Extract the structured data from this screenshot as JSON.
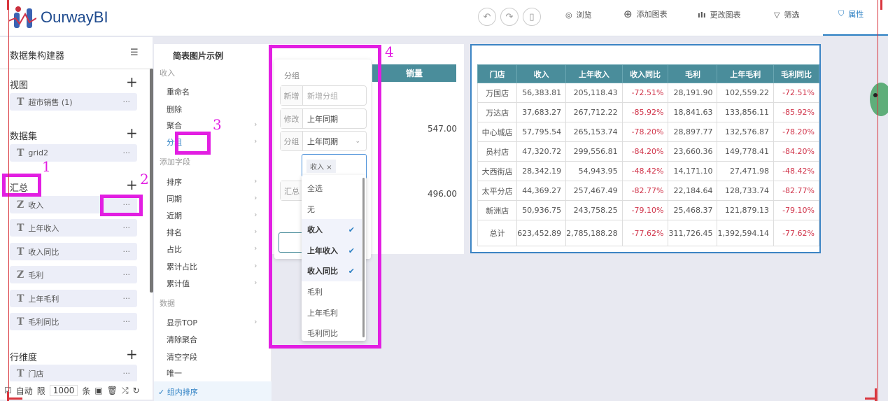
{
  "header": {
    "app_name": "OurwayBI",
    "tools": [
      {
        "icon": "eye-icon",
        "label": "浏览"
      },
      {
        "icon": "plus-circle-icon",
        "label": "添加图表"
      },
      {
        "icon": "bar-chart-icon",
        "label": "更改图表"
      },
      {
        "icon": "filter-icon",
        "label": "筛选"
      },
      {
        "icon": "shirt-icon",
        "label": "属性"
      }
    ]
  },
  "left": {
    "title": "数据集构建器",
    "sections": [
      {
        "title": "视图",
        "fields": [
          {
            "type": "T",
            "name": "超市销售 (1)"
          }
        ]
      },
      {
        "title": "数据集",
        "fields": [
          {
            "type": "T",
            "name": "grid2"
          }
        ]
      },
      {
        "title": "汇总",
        "fields": [
          {
            "type": "Z",
            "name": "收入"
          },
          {
            "type": "T",
            "name": "上年收入"
          },
          {
            "type": "T",
            "name": "收入同比"
          },
          {
            "type": "Z",
            "name": "毛利"
          },
          {
            "type": "T",
            "name": "上年毛利"
          },
          {
            "type": "T",
            "name": "毛利同比"
          }
        ]
      },
      {
        "title": "行维度",
        "fields": [
          {
            "type": "T",
            "name": "门店"
          }
        ]
      }
    ],
    "more": "···"
  },
  "bottom": {
    "auto": "自动",
    "limit_label": "限",
    "limit": "1000",
    "unit": "条"
  },
  "chart_title": "简表图片示例",
  "menu": {
    "header1": "收入",
    "items1": [
      "重命名",
      "删除",
      "聚合",
      "分组"
    ],
    "header2": "添加字段",
    "items2": [
      "排序",
      "同期",
      "近期",
      "排名",
      "占比",
      "累计占比",
      "累计值"
    ],
    "header3": "数据",
    "items3": [
      "显示TOP",
      "清除聚合",
      "清空字段",
      "唯一"
    ],
    "checked": "✓ 组内排序"
  },
  "bgtable": {
    "header": "销量",
    "values": [
      "547.00",
      "496.00"
    ]
  },
  "group": {
    "title": "分组",
    "rows": [
      {
        "label": "新增",
        "value": "新增分组",
        "placeholder": true
      },
      {
        "label": "修改",
        "value": "上年同期"
      },
      {
        "label": "分组",
        "value": "上年同期"
      },
      {
        "label": "汇总",
        "value": ""
      }
    ],
    "tag": "收入"
  },
  "dropdown": {
    "options": [
      {
        "label": "全选",
        "sel": false
      },
      {
        "label": "无",
        "sel": false
      },
      {
        "label": "收入",
        "sel": true
      },
      {
        "label": "上年收入",
        "sel": true
      },
      {
        "label": "收入同比",
        "sel": true
      },
      {
        "label": "毛利",
        "sel": false
      },
      {
        "label": "上年毛利",
        "sel": false
      },
      {
        "label": "毛利同比",
        "sel": false
      }
    ]
  },
  "table": {
    "columns": [
      "门店",
      "收入",
      "上年收入",
      "收入同比",
      "毛利",
      "上年毛利",
      "毛利同比"
    ],
    "rows": [
      [
        "万国店",
        "56,383.81",
        "205,118.43",
        "-72.51%",
        "28,191.90",
        "102,559.22",
        "-72.51%"
      ],
      [
        "万达店",
        "37,683.27",
        "267,712.22",
        "-85.92%",
        "18,841.63",
        "133,856.11",
        "-85.92%"
      ],
      [
        "中心城店",
        "57,795.54",
        "265,153.74",
        "-78.20%",
        "28,897.77",
        "132,576.87",
        "-78.20%"
      ],
      [
        "员村店",
        "47,320.72",
        "299,556.81",
        "-84.20%",
        "23,660.36",
        "149,778.41",
        "-84.20%"
      ],
      [
        "大西街店",
        "28,342.19",
        "54,943.95",
        "-48.42%",
        "14,171.10",
        "27,471.98",
        "-48.42%"
      ],
      [
        "太平分店",
        "44,369.27",
        "257,467.49",
        "-82.77%",
        "22,184.64",
        "128,733.74",
        "-82.77%"
      ],
      [
        "新洲店",
        "50,936.75",
        "243,758.25",
        "-79.10%",
        "25,468.37",
        "121,879.13",
        "-79.10%"
      ],
      [
        "总计",
        "623,452.89",
        "2,785,188.28",
        "-77.62%",
        "311,726.45",
        "1,392,594.14",
        "-77.62%"
      ]
    ]
  },
  "annotations": [
    "1",
    "2",
    "3",
    "4"
  ],
  "colors": {
    "accent": "#2b7fc3",
    "header_teal": "#4a8d9b",
    "negative": "#d0344a",
    "annotation": "#e21ee2"
  }
}
